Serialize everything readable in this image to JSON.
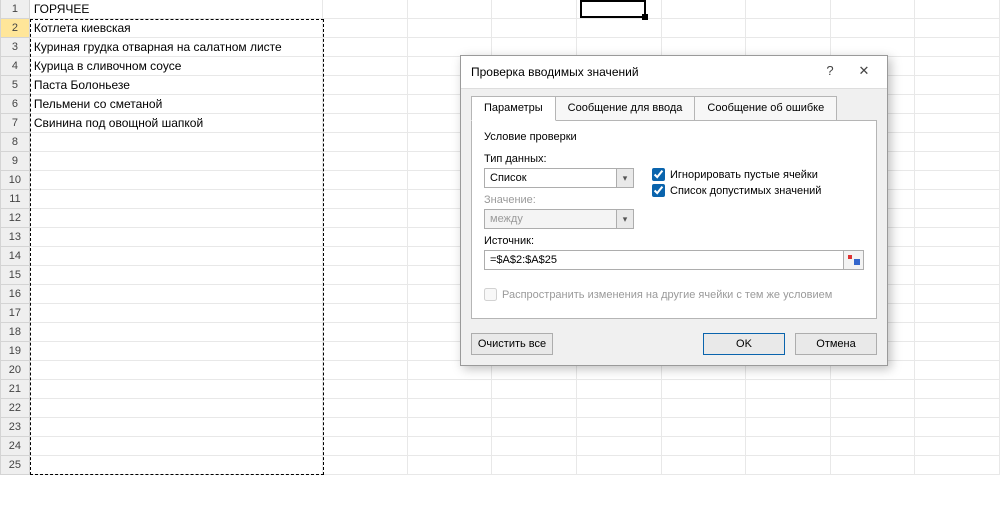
{
  "sheet": {
    "rows": [
      {
        "n": 1,
        "a": "ГОРЯЧЕЕ"
      },
      {
        "n": 2,
        "a": "Котлета киевская",
        "highlight": true
      },
      {
        "n": 3,
        "a": "Куриная грудка отварная на салатном листе"
      },
      {
        "n": 4,
        "a": "Курица в сливочном соусе"
      },
      {
        "n": 5,
        "a": "Паста Болоньезе"
      },
      {
        "n": 6,
        "a": "Пельмени со сметаной"
      },
      {
        "n": 7,
        "a": "Свинина под овощной шапкой"
      },
      {
        "n": 8,
        "a": ""
      },
      {
        "n": 9,
        "a": ""
      },
      {
        "n": 10,
        "a": ""
      },
      {
        "n": 11,
        "a": ""
      },
      {
        "n": 12,
        "a": ""
      },
      {
        "n": 13,
        "a": ""
      },
      {
        "n": 14,
        "a": ""
      },
      {
        "n": 15,
        "a": ""
      },
      {
        "n": 16,
        "a": ""
      },
      {
        "n": 17,
        "a": ""
      },
      {
        "n": 18,
        "a": ""
      },
      {
        "n": 19,
        "a": ""
      },
      {
        "n": 20,
        "a": ""
      },
      {
        "n": 21,
        "a": ""
      },
      {
        "n": 22,
        "a": ""
      },
      {
        "n": 23,
        "a": ""
      },
      {
        "n": 24,
        "a": ""
      },
      {
        "n": 25,
        "a": ""
      }
    ]
  },
  "dialog": {
    "title": "Проверка вводимых значений",
    "help": "?",
    "close": "✕",
    "tabs": {
      "params": "Параметры",
      "input_msg": "Сообщение для ввода",
      "error_msg": "Сообщение об ошибке"
    },
    "group_title": "Условие проверки",
    "type_label": "Тип данных:",
    "type_value": "Список",
    "data_label": "Значение:",
    "data_value": "между",
    "ignore_blank": "Игнорировать пустые ячейки",
    "in_cell_dropdown": "Список допустимых значений",
    "source_label": "Источник:",
    "source_value": "=$A$2:$A$25",
    "apply_changes": "Распространить изменения на другие ячейки с тем же условием",
    "clear_all": "Очистить все",
    "ok": "OK",
    "cancel": "Отмена"
  }
}
